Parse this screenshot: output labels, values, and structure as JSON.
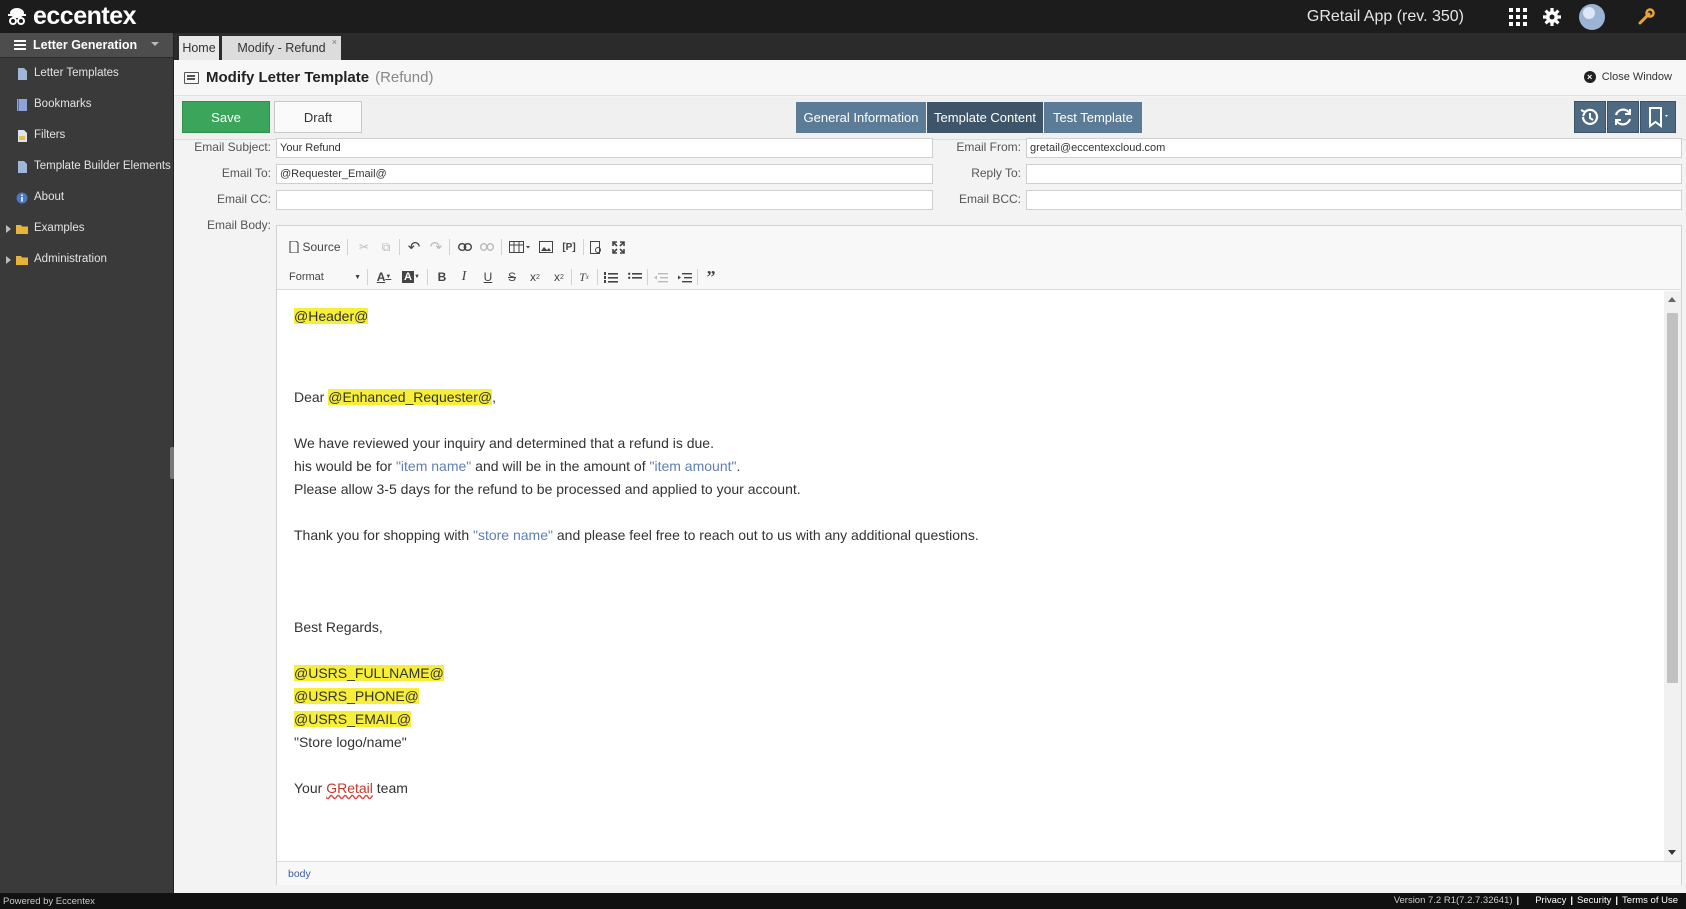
{
  "app": {
    "logo_text": "eccentex",
    "app_name": "GRetail App (rev. 350)"
  },
  "sidebar": {
    "header": "Letter Generation",
    "items": [
      {
        "label": "Letter Templates"
      },
      {
        "label": "Bookmarks"
      },
      {
        "label": "Filters"
      },
      {
        "label": "Template Builder Elements"
      },
      {
        "label": "About"
      },
      {
        "label": "Examples"
      },
      {
        "label": "Administration"
      }
    ]
  },
  "tabs": {
    "home": "Home",
    "modify": "Modify - Refund",
    "close": "×"
  },
  "page": {
    "title": "Modify Letter Template",
    "subtitle": "(Refund)",
    "close_window": "Close Window"
  },
  "toolbar": {
    "save": "Save",
    "draft": "Draft",
    "segments": [
      "General Information",
      "Template Content",
      "Test Template"
    ]
  },
  "form": {
    "subject_label": "Email Subject:",
    "subject_value": "Your Refund",
    "to_label": "Email To:",
    "to_value": "@Requester_Email@",
    "cc_label": "Email CC:",
    "cc_value": "",
    "body_label": "Email Body:",
    "from_label": "Email From:",
    "from_value": "gretail@eccentexcloud.com",
    "reply_label": "Reply To:",
    "reply_value": "",
    "bcc_label": "Email BCC:",
    "bcc_value": ""
  },
  "editor": {
    "source_label": "Source",
    "format_label": "Format",
    "status_path": "body",
    "content": {
      "header_token": "@Header@",
      "dear": "Dear ",
      "requester_token": "@Enhanced_Requester@",
      "comma": ",",
      "p1": "We have reviewed your inquiry and determined that a refund is due.",
      "p2_a": "his would be for ",
      "p2_item": "\"item name\"",
      "p2_b": " and will be in the amount of ",
      "p2_amount": "\"item amount\"",
      "p2_c": ".",
      "p3": "Please allow 3-5 days for the refund to be processed and applied to your account.",
      "p4_a": "Thank you for shopping with ",
      "p4_store": "\"store name\"",
      "p4_b": " and please feel free to reach out to us with any additional questions.",
      "regards": "Best Regards,",
      "fullname_token": "@USRS_FULLNAME@",
      "phone_token": "@USRS_PHONE@",
      "email_token": "@USRS_EMAIL@",
      "logo_line": "\"Store logo/name\"",
      "team_a": "Your ",
      "team_brand": "GRetail",
      "team_b": " team"
    }
  },
  "footer": {
    "powered": "Powered by Eccentex",
    "version": "Version  7.2 R1(7.2.7.32641)",
    "privacy": "Privacy",
    "security": "Security",
    "terms": "Terms of Use"
  }
}
